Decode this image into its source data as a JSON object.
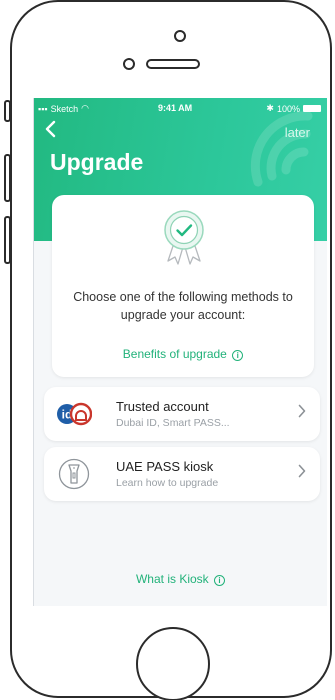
{
  "status_bar": {
    "carrier": "Sketch",
    "time": "9:41 AM",
    "battery": "100%"
  },
  "nav": {
    "back_icon": "chevron-left-icon",
    "later_label": "later"
  },
  "page_title": "Upgrade",
  "intro": {
    "description": "Choose one of the following methods to upgrade your account:",
    "benefits_link": "Benefits of upgrade"
  },
  "options": [
    {
      "title": "Trusted account",
      "subtitle": "Dubai ID, Smart PASS...",
      "icon": "trusted-account-logo-icon"
    },
    {
      "title": "UAE PASS kiosk",
      "subtitle": "Learn how to upgrade",
      "icon": "kiosk-icon"
    }
  ],
  "footer_link": "What is Kiosk",
  "colors": {
    "accent": "#22b981",
    "link": "#22b27a"
  }
}
